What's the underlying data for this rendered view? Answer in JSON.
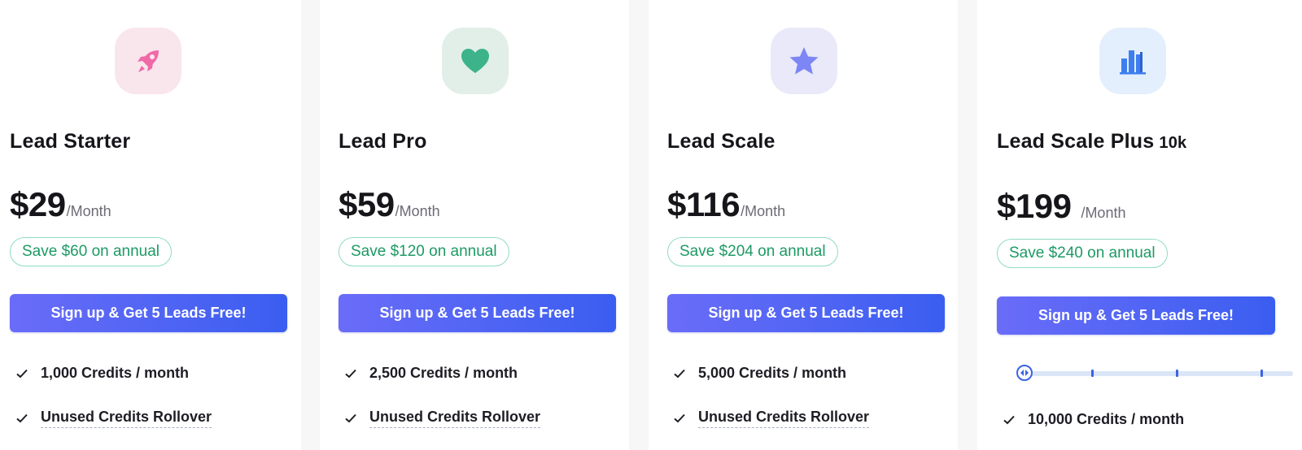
{
  "plans": [
    {
      "title": "Lead Starter",
      "title_suffix": "",
      "price": "$29",
      "period": "/Month",
      "save": "Save $60 on annual",
      "cta": "Sign up & Get 5 Leads Free!",
      "features": [
        "1,000 Credits / month",
        "Unused Credits Rollover"
      ],
      "icon": "rocket-icon",
      "icon_color": "#f06aa8",
      "icon_bg": "#f9e6ec"
    },
    {
      "title": "Lead Pro",
      "title_suffix": "",
      "price": "$59",
      "period": "/Month",
      "save": "Save $120 on annual",
      "cta": "Sign up & Get 5 Leads Free!",
      "features": [
        "2,500 Credits / month",
        "Unused Credits Rollover"
      ],
      "icon": "heart-icon",
      "icon_color": "#3cb38a",
      "icon_bg": "#e2efe9"
    },
    {
      "title": "Lead Scale",
      "title_suffix": "",
      "price": "$116",
      "period": "/Month",
      "save": "Save $204 on annual",
      "cta": "Sign up & Get 5 Leads Free!",
      "features": [
        "5,000 Credits / month",
        "Unused Credits Rollover"
      ],
      "icon": "star-icon",
      "icon_color": "#7d86f5",
      "icon_bg": "#e9e9f9"
    },
    {
      "title": "Lead Scale Plus",
      "title_suffix": "10k",
      "price": "$199",
      "period": "/Month",
      "save": "Save $240 on annual",
      "cta": "Sign up & Get 5 Leads Free!",
      "features": [
        "10,000 Credits / month"
      ],
      "icon": "bar-chart-icon",
      "icon_color": "#3d7ff0",
      "icon_bg": "#e3effc",
      "slider": {
        "position": 0
      }
    }
  ]
}
